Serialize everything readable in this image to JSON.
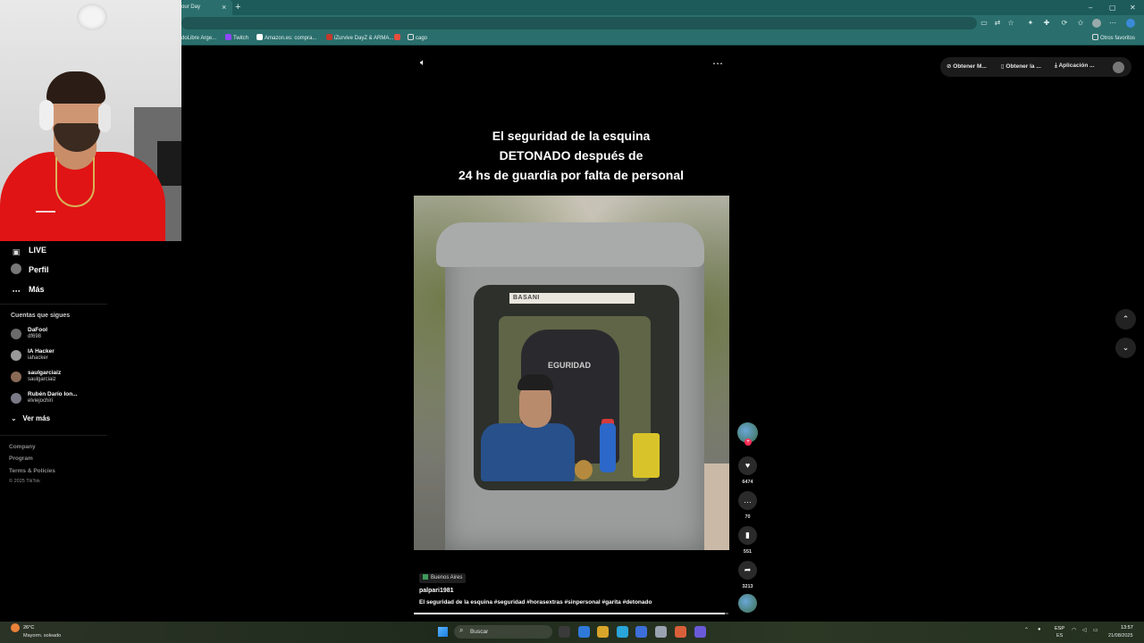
{
  "browser": {
    "tab_title": "our Day",
    "tab_close": "×",
    "new_tab": "+",
    "window_controls": [
      "–",
      "▢",
      "✕"
    ],
    "bookmarks": [
      {
        "label": "doLibre Arge...",
        "color": "#f4d23b"
      },
      {
        "label": "Twitch",
        "color": "#9146ff"
      },
      {
        "label": "Amazon.es: compra...",
        "color": "#ffffff"
      },
      {
        "label": "iZurvive DayZ & ARMA...",
        "color": "#c0392b"
      },
      {
        "label": "",
        "color": "#e84d3d"
      },
      {
        "label": "cago",
        "color": "#e0e0e0"
      }
    ],
    "other_favorites": "Otros favoritos"
  },
  "sidebar": {
    "items": [
      {
        "label": "LIVE",
        "icon": "live-icon"
      },
      {
        "label": "Perfil",
        "icon": "profile-avatar"
      },
      {
        "label": "Más",
        "icon": "more-dots-icon"
      }
    ],
    "following_title": "Cuentas que sigues",
    "following": [
      {
        "name": "DaFool",
        "handle": "df698"
      },
      {
        "name": "IA Hacker",
        "handle": "iahacker"
      },
      {
        "name": "saulgarciaiz",
        "handle": "saulgarciaiz"
      },
      {
        "name": "Rubén Darío Ion...",
        "handle": "elviejochiri"
      }
    ],
    "see_more": "Ver más",
    "footer": [
      "Company",
      "Program",
      "Terms & Policies"
    ],
    "copyright": "© 2025 TikTok"
  },
  "video": {
    "headline_lines": [
      "El seguridad de la esquina",
      "DETONADO después de",
      "24 hs de guardia por falta de personal"
    ],
    "sign_text": "BASANI",
    "jacket_text": "EGURIDAD",
    "location": "Buenos Aires",
    "author": "palpari1981",
    "caption": "El seguridad de la esquina #seguridad  #horasextras  #sinpersonal  #garita  #detonado",
    "progress": 0.99,
    "actions": [
      {
        "name": "like",
        "icon": "♥",
        "count": "6474"
      },
      {
        "name": "comment",
        "icon": "…",
        "count": "70"
      },
      {
        "name": "save",
        "icon": "▮",
        "count": "551"
      },
      {
        "name": "share",
        "icon": "➦",
        "count": "3213"
      }
    ]
  },
  "top_actions": [
    "Obtener M...",
    "Obtener la ...",
    "Aplicación ..."
  ],
  "taskbar": {
    "temp": "26°C",
    "weather": "Mayorm. soleado",
    "search_placeholder": "Buscar",
    "lang_top": "ESP",
    "lang_bottom": "ES",
    "time": "13:57",
    "date": "21/08/2025",
    "apps": [
      "#3a3a3a",
      "#2f7ad9",
      "#d9a42a",
      "#2aa5d9",
      "#3c6fd9",
      "#9aa3b0",
      "#d95f3a",
      "#6a5ad9"
    ]
  }
}
